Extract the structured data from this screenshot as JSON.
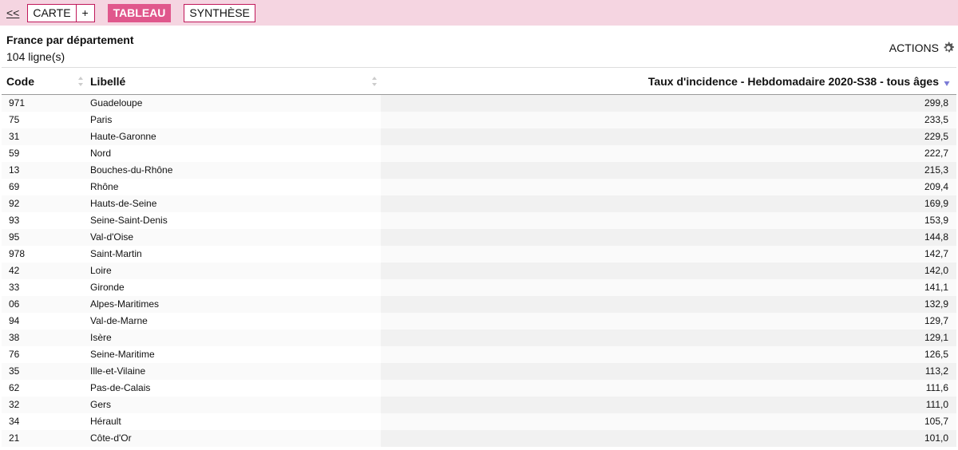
{
  "nav": {
    "back": "<<",
    "tabs": [
      {
        "label": "CARTE",
        "plus": "+"
      },
      {
        "label": "TABLEAU"
      },
      {
        "label": "SYNTHÈSE"
      }
    ],
    "active_color": "#e0578c",
    "bar_color": "#f5d5e1"
  },
  "header": {
    "title": "France par département",
    "row_count": "104 ligne(s)",
    "actions_label": "ACTIONS",
    "actions_icon": "gear-icon"
  },
  "table": {
    "columns": [
      "Code",
      "Libellé",
      "Taux d'incidence - Hebdomadaire 2020-S38 - tous âges"
    ],
    "sort": {
      "column": 2,
      "direction": "descending"
    },
    "rows": [
      [
        "971",
        "Guadeloupe",
        "299,8"
      ],
      [
        "75",
        "Paris",
        "233,5"
      ],
      [
        "31",
        "Haute-Garonne",
        "229,5"
      ],
      [
        "59",
        "Nord",
        "222,7"
      ],
      [
        "13",
        "Bouches-du-Rhône",
        "215,3"
      ],
      [
        "69",
        "Rhône",
        "209,4"
      ],
      [
        "92",
        "Hauts-de-Seine",
        "169,9"
      ],
      [
        "93",
        "Seine-Saint-Denis",
        "153,9"
      ],
      [
        "95",
        "Val-d'Oise",
        "144,8"
      ],
      [
        "978",
        "Saint-Martin",
        "142,7"
      ],
      [
        "42",
        "Loire",
        "142,0"
      ],
      [
        "33",
        "Gironde",
        "141,1"
      ],
      [
        "06",
        "Alpes-Maritimes",
        "132,9"
      ],
      [
        "94",
        "Val-de-Marne",
        "129,7"
      ],
      [
        "38",
        "Isère",
        "129,1"
      ],
      [
        "76",
        "Seine-Maritime",
        "126,5"
      ],
      [
        "35",
        "Ille-et-Vilaine",
        "113,2"
      ],
      [
        "62",
        "Pas-de-Calais",
        "111,6"
      ],
      [
        "32",
        "Gers",
        "111,0"
      ],
      [
        "34",
        "Hérault",
        "105,7"
      ],
      [
        "21",
        "Côte-d'Or",
        "101,0"
      ]
    ]
  }
}
